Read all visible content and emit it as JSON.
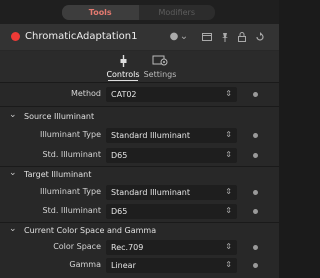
{
  "mode_tabs": {
    "tools": "Tools",
    "modifiers": "Modifiers"
  },
  "node": {
    "name": "ChromaticAdaptation1",
    "accent_color": "#ee3a36"
  },
  "header_icons": [
    "dot-menu-icon",
    "chevron-down-icon",
    "window-icon",
    "pin-icon",
    "lock-icon",
    "reset-icon"
  ],
  "panel_tabs": [
    {
      "label": "Controls",
      "active": true
    },
    {
      "label": "Settings",
      "active": false
    }
  ],
  "method": {
    "label": "Method",
    "value": "CAT02"
  },
  "source": {
    "title": "Source Illuminant",
    "type_label": "Illuminant Type",
    "type_value": "Standard Illuminant",
    "std_label": "Std. Illuminant",
    "std_value": "D65"
  },
  "target": {
    "title": "Target Illuminant",
    "type_label": "Illuminant Type",
    "type_value": "Standard Illuminant",
    "std_label": "Std. Illuminant",
    "std_value": "D65"
  },
  "color": {
    "title": "Current Color Space and Gamma",
    "space_label": "Color Space",
    "space_value": "Rec.709",
    "gamma_label": "Gamma",
    "gamma_value": "Linear"
  }
}
